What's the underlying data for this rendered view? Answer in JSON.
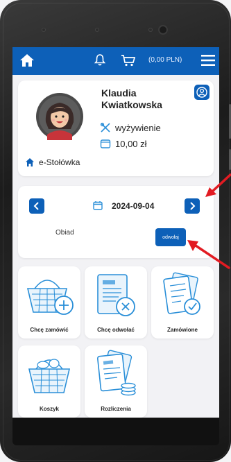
{
  "colors": {
    "brand": "#0d60b8",
    "arrow": "#e21b22",
    "icon_line": "#2a8fd8"
  },
  "header": {
    "home_icon": "home-icon",
    "bell_icon": "bell-icon",
    "cart_icon": "cart-icon",
    "cart_total": "(0,00 PLN)",
    "menu_icon": "hamburger-menu-icon"
  },
  "profile": {
    "first_name": "Klaudia",
    "last_name": "Kwiatkowska",
    "service": "wyżywienie",
    "balance": "10,00 zł",
    "school": "e-Stołówka",
    "account_icon": "user-circle-icon"
  },
  "day": {
    "date": "2024-09-04",
    "meal": "Obiad",
    "cancel_label": "odwołaj"
  },
  "tiles": [
    {
      "label": "Chcę zamówić",
      "icon": "basket-plus-icon"
    },
    {
      "label": "Chcę odwołać",
      "icon": "document-cancel-icon"
    },
    {
      "label": "Zamówione",
      "icon": "documents-check-icon"
    },
    {
      "label": "Koszyk",
      "icon": "basket-icon"
    },
    {
      "label": "Rozliczenia",
      "icon": "documents-coins-icon"
    }
  ]
}
